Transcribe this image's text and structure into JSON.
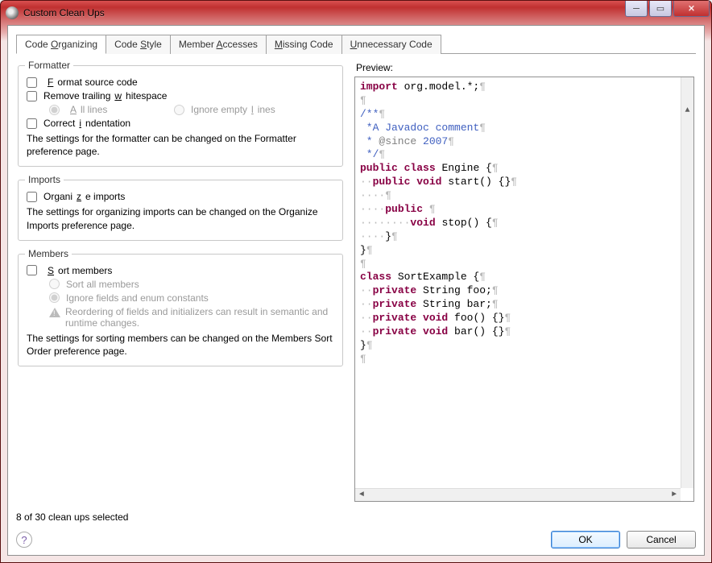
{
  "window": {
    "title": "Custom Clean Ups"
  },
  "winbtns": {
    "min": "─",
    "max": "▭",
    "close": "✕"
  },
  "tabs": [
    {
      "label_pre": "Code ",
      "label_ul": "O",
      "label_post": "rganizing",
      "active": true
    },
    {
      "label_pre": "Code ",
      "label_ul": "S",
      "label_post": "tyle",
      "active": false
    },
    {
      "label_pre": "Member ",
      "label_ul": "A",
      "label_post": "ccesses",
      "active": false
    },
    {
      "label_pre": "",
      "label_ul": "M",
      "label_post": "issing Code",
      "active": false
    },
    {
      "label_pre": "",
      "label_ul": "U",
      "label_post": "nnecessary Code",
      "active": false
    }
  ],
  "formatter": {
    "title": "Formatter",
    "format_lbl_pre": "",
    "format_ul": "F",
    "format_lbl_post": "ormat source code",
    "trail_lbl_pre": "Remove trailing ",
    "trail_ul": "w",
    "trail_lbl_post": "hitespace",
    "radio_all_pre": "",
    "radio_all_ul": "A",
    "radio_all_post": "ll lines",
    "radio_ign_pre": "Ignore empty ",
    "radio_ign_ul": "l",
    "radio_ign_post": "ines",
    "correct_pre": "Correct ",
    "correct_ul": "i",
    "correct_post": "ndentation",
    "desc": "The settings for the formatter can be changed on the Formatter preference page."
  },
  "imports": {
    "title": "Imports",
    "org_pre": "Organi",
    "org_ul": "z",
    "org_post": "e imports",
    "desc": "The settings for organizing imports can be changed on the Organize Imports preference page."
  },
  "members": {
    "title": "Members",
    "sort_pre": "",
    "sort_ul": "S",
    "sort_post": "ort members",
    "radio_all": "Sort all members",
    "radio_ign": "Ignore fields and enum constants",
    "warn": "Reordering of fields and initializers can result in semantic and runtime changes.",
    "desc": "The settings for sorting members can be changed on the Members Sort Order preference page."
  },
  "preview_label": "Preview:",
  "preview": {
    "l1_kw": "import",
    "l1_rest": " org.model.*;",
    "l2": "/**",
    "l3": " *A Javadoc comment",
    "l4a": " * ",
    "l4b": "@since",
    "l4c": " 2007",
    "l5": " */",
    "l6_kw": "public",
    "l6_kw2": "class",
    "l6_rest": " Engine {",
    "l7_kw": "public",
    "l7_kw2": "void",
    "l7_rest": " start() {}",
    "l8_kw": "public",
    "l9_kw": "void",
    "l9_rest": " stop() {",
    "l10": "}",
    "l11": "}",
    "l13_kw": "class",
    "l13_rest": " SortExample {",
    "l14_kw": "private",
    "l14_rest": " String foo;",
    "l15_kw": "private",
    "l15_rest": " String bar;",
    "l16_kw": "private",
    "l16_kw2": "void",
    "l16_rest": " foo() {}",
    "l17_kw": "private",
    "l17_kw2": "void",
    "l17_rest": " bar() {}",
    "l18": "}"
  },
  "status": "8 of 30 clean ups selected",
  "buttons": {
    "ok": "OK",
    "cancel": "Cancel"
  }
}
